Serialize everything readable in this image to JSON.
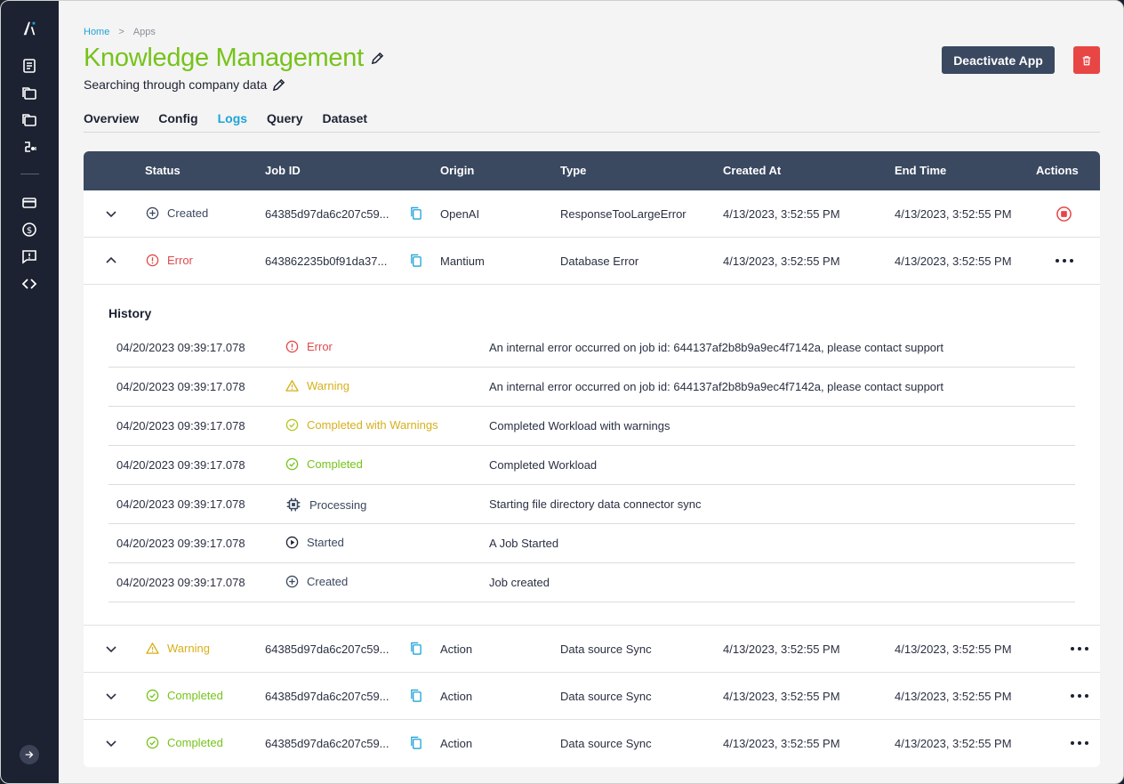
{
  "breadcrumb": {
    "home": "Home",
    "separator": ">",
    "current": "Apps"
  },
  "app": {
    "title": "Knowledge Management",
    "subtitle": "Searching through company data"
  },
  "buttons": {
    "deactivate": "Deactivate App"
  },
  "tabs": [
    {
      "label": "Overview",
      "active": false
    },
    {
      "label": "Config",
      "active": false
    },
    {
      "label": "Logs",
      "active": true
    },
    {
      "label": "Query",
      "active": false
    },
    {
      "label": "Dataset",
      "active": false
    }
  ],
  "table": {
    "headers": [
      "Status",
      "Job ID",
      "Origin",
      "Type",
      "Created At",
      "End Time",
      "Actions"
    ],
    "rows": [
      {
        "status": "Created",
        "job_id": "64385d97da6c207c59...",
        "origin": "OpenAI",
        "type": "ResponseTooLargeError",
        "created_at": "4/13/2023, 3:52:55 PM",
        "end_time": "4/13/2023, 3:52:55 PM"
      },
      {
        "status": "Error",
        "job_id": "643862235b0f91da37...",
        "origin": "Mantium",
        "type": "Database Error",
        "created_at": "4/13/2023, 3:52:55 PM",
        "end_time": "4/13/2023, 3:52:55 PM"
      },
      {
        "status": "Warning",
        "job_id": "64385d97da6c207c59...",
        "origin": "Action",
        "type": "Data source Sync",
        "created_at": "4/13/2023, 3:52:55 PM",
        "end_time": "4/13/2023, 3:52:55 PM"
      },
      {
        "status": "Completed",
        "job_id": "64385d97da6c207c59...",
        "origin": "Action",
        "type": "Data source Sync",
        "created_at": "4/13/2023, 3:52:55 PM",
        "end_time": "4/13/2023, 3:52:55 PM"
      },
      {
        "status": "Completed",
        "job_id": "64385d97da6c207c59...",
        "origin": "Action",
        "type": "Data source Sync",
        "created_at": "4/13/2023, 3:52:55 PM",
        "end_time": "4/13/2023, 3:52:55 PM"
      }
    ]
  },
  "history": {
    "title": "History",
    "items": [
      {
        "date": "04/20/2023 09:39:17.078",
        "status": "Error",
        "message": "An internal error occurred on job id: 644137af2b8b9a9ec4f7142a, please contact support"
      },
      {
        "date": "04/20/2023 09:39:17.078",
        "status": "Warning",
        "message": "An internal error occurred on job id: 644137af2b8b9a9ec4f7142a, please contact support"
      },
      {
        "date": "04/20/2023 09:39:17.078",
        "status": "Completed with Warnings",
        "message": "Completed Workload with warnings"
      },
      {
        "date": "04/20/2023 09:39:17.078",
        "status": "Completed",
        "message": "Completed Workload"
      },
      {
        "date": "04/20/2023 09:39:17.078",
        "status": "Processing",
        "message": "Starting file directory data connector sync"
      },
      {
        "date": "04/20/2023 09:39:17.078",
        "status": "Started",
        "message": "A Job Started"
      },
      {
        "date": "04/20/2023 09:39:17.078",
        "status": "Created",
        "message": "Job created"
      }
    ]
  },
  "colors": {
    "accent": "#1ea4d8",
    "title_green": "#76c31a",
    "header_bg": "#3a4860",
    "sidebar_bg": "#1c2232",
    "error": "#e04a4a",
    "warning": "#d6b01b",
    "success": "#76c31a",
    "delete": "#e84545"
  }
}
